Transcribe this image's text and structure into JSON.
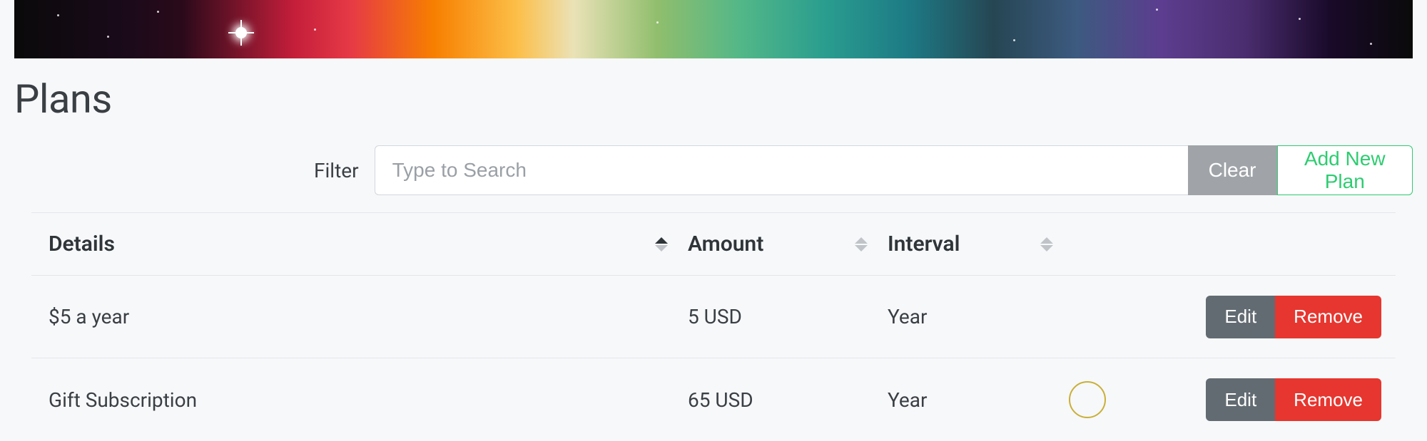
{
  "page": {
    "title": "Plans"
  },
  "filter": {
    "label": "Filter",
    "placeholder": "Type to Search",
    "clear_label": "Clear",
    "add_label": "Add New Plan"
  },
  "table": {
    "columns": {
      "details": "Details",
      "amount": "Amount",
      "interval": "Interval"
    },
    "rows": [
      {
        "details": "$5 a year",
        "amount": "5 USD",
        "interval": "Year"
      },
      {
        "details": "Gift Subscription",
        "amount": "65 USD",
        "interval": "Year"
      }
    ],
    "actions": {
      "edit": "Edit",
      "remove": "Remove"
    }
  }
}
